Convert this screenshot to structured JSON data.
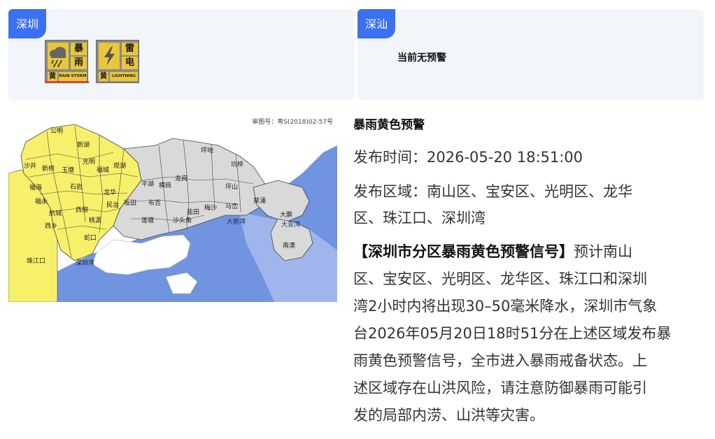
{
  "cards": [
    {
      "city": "深圳",
      "warnings": [
        {
          "name": "暴雨",
          "char1": "暴",
          "char2": "雨",
          "level": "黄",
          "en": "RAIN STORM",
          "icon": "rain-cloud-icon"
        },
        {
          "name": "雷电",
          "char1": "雷",
          "char2": "电",
          "level": "黄",
          "en": "LIGHTNING",
          "icon": "lightning-bolt-icon"
        }
      ],
      "selected": 0
    },
    {
      "city": "深汕",
      "no_alert": "当前无预警"
    }
  ],
  "map": {
    "review_no": "审图号：粤S(2018)02-57号",
    "labels": {
      "gongming": "公明",
      "xinhu": "新湖",
      "shajing": "沙井",
      "xinqiao": "新桥",
      "yutang": "玉塘",
      "guangming": "光明",
      "fucheng": "福城",
      "guanhu": "观湖",
      "shiyan": "石岩",
      "fuhai": "福海",
      "fuyong": "福永",
      "hangcheng": "航城",
      "xixiang": "西乡",
      "xili": "西丽",
      "taoyuan": "桃源",
      "longhua": "龙华",
      "minzhi": "民治",
      "bantian": "坂田",
      "zhujiangkou": "珠江口",
      "shekou": "蛇口",
      "shenzhenwan": "深圳湾",
      "pingdi": "坪地",
      "pingshan": "坪山",
      "kengzi": "坑梓",
      "longgang": "龙岗",
      "yantian": "盐田",
      "dapeng": "大鹏",
      "nanao": "南澳",
      "kuichong": "葵涌",
      "dapengwan": "大鹏湾",
      "dayawan": "大亚湾",
      "henggang": "横岗",
      "pinghu": "平湖",
      "buji": "布吉",
      "meisha": "梅沙",
      "matian": "马峦",
      "shatoujiao": "沙头角",
      "lianhua": "莲塘"
    },
    "colors": {
      "warned": "#f7f06a",
      "normal": "#d9d9d9",
      "sea": "#7194e0",
      "sea_light": "#9fb5ec",
      "border": "#444444"
    }
  },
  "detail": {
    "title": "暴雨黄色预警",
    "time_label": "发布时间：",
    "time_value": "2026-05-20 18:51:00",
    "area_line1": "发布区域：南山区、宝安区、光明区、龙华",
    "area_line2": "区、珠江口、深圳湾",
    "desc_title": "【深圳市分区暴雨黄色预警信号】",
    "desc_lines": [
      "预计南山",
      "区、宝安区、光明区、龙华区、珠江口和深圳",
      "湾2小时内将出现30–50毫米降水，深圳市气象",
      "台2026年05月20日18时51分在上述区域发布暴",
      "雨黄色预警信号，全市进入暴雨戒备状态。上",
      "述区域存在山洪风险，请注意防御暴雨可能引",
      "发的局部内涝、山洪等灾害。"
    ]
  }
}
